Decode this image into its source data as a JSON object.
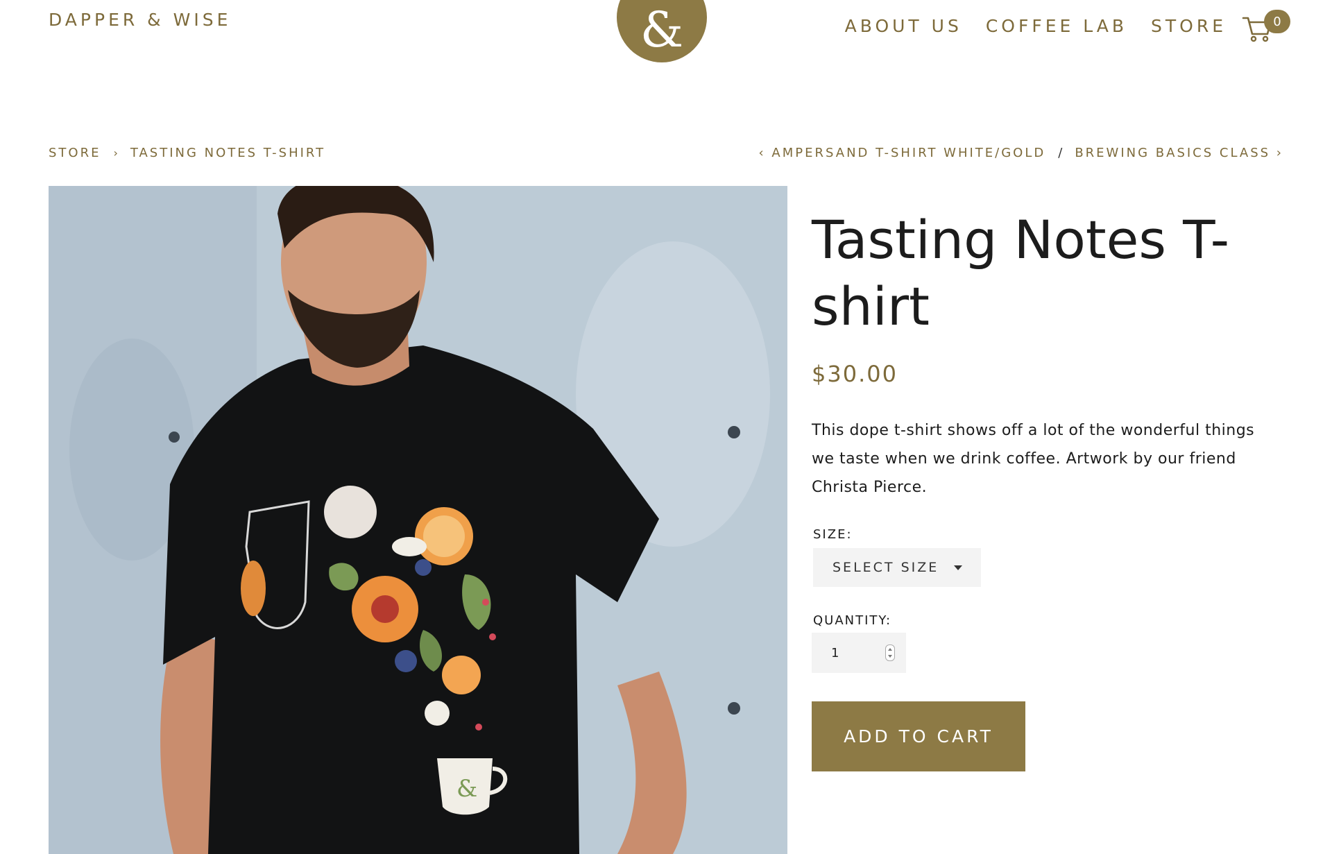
{
  "header": {
    "brand": "DAPPER & WISE",
    "logo_glyph": "&",
    "nav": [
      "ABOUT US",
      "COFFEE LAB",
      "STORE"
    ],
    "cart_count": "0",
    "cart_icon": "cart-icon"
  },
  "breadcrumb": {
    "items": [
      "STORE",
      "TASTING NOTES T-SHIRT"
    ],
    "separator": "›"
  },
  "pager": {
    "prev": "‹ AMPERSAND T-SHIRT WHITE/GOLD",
    "divider": "/",
    "next": "BREWING BASICS CLASS ›"
  },
  "product": {
    "title": "Tasting Notes T-shirt",
    "price": "$30.00",
    "description": "This dope t-shirt shows off a lot of the wonderful things we taste when we drink coffee. Artwork by our friend Christa Pierce.",
    "size_label": "SIZE:",
    "size_value": "SELECT SIZE",
    "quantity_label": "QUANTITY:",
    "quantity_value": "1",
    "add_to_cart": "ADD TO CART"
  },
  "colors": {
    "accent": "#8d7a45",
    "accent_text": "#7d6a3a",
    "input_bg": "#f3f3f3"
  }
}
